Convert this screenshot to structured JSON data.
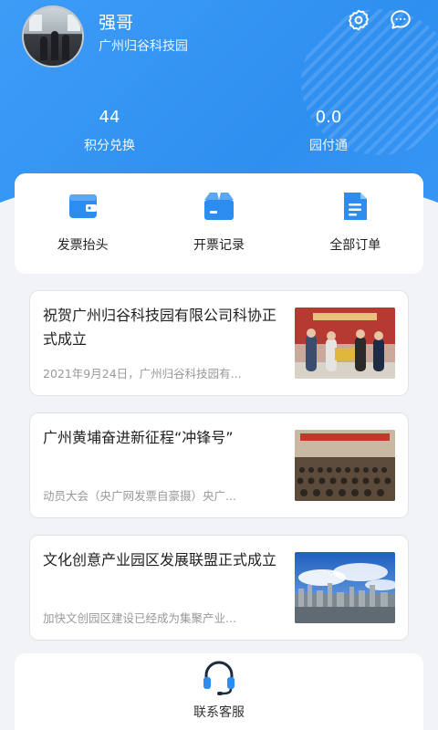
{
  "profile": {
    "name": "强哥",
    "organization": "广州归谷科技园",
    "avatar": "avatar-photo"
  },
  "header_icons": [
    "gear-icon",
    "chat-bubble-icon"
  ],
  "stats": [
    {
      "value": "44",
      "label": "积分兑换"
    },
    {
      "value": "0.0",
      "label": "园付通"
    }
  ],
  "quick_actions": [
    {
      "label": "发票抬头",
      "icon": "wallet-icon"
    },
    {
      "label": "开票记录",
      "icon": "open-box-icon"
    },
    {
      "label": "全部订单",
      "icon": "document-icon"
    }
  ],
  "news": [
    {
      "title": "祝贺广州归谷科技园有限公司科协正式成立",
      "summary": "2021年9月24日，广州归谷科技园有...",
      "image": "group-photo-ceremony"
    },
    {
      "title": "广州黄埔奋进新征程“冲锋号”",
      "summary": "动员大会（央广网发票自豪摄）央广...",
      "image": "conference-hall-photo"
    },
    {
      "title": "文化创意产业园区发展联盟正式成立",
      "summary": "加快文创园区建设已经成为集聚产业...",
      "image": "city-skyline-photo"
    }
  ],
  "customer_service": {
    "label": "联系客服",
    "icon": "headset-icon"
  },
  "colors": {
    "primary": "#2f8ff0",
    "icon_blue": "#2d8cf0",
    "background": "#f2f3f7"
  }
}
